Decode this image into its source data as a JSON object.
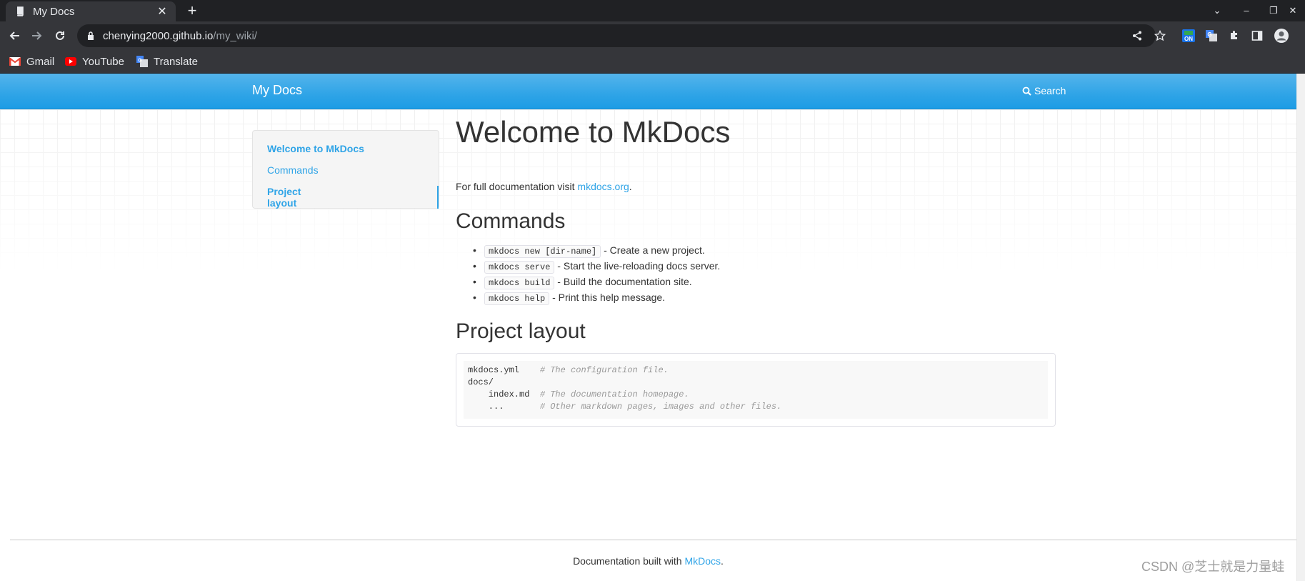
{
  "browser": {
    "tab_title": "My Docs",
    "url_host": "chenying2000.github.io",
    "url_path": "/my_wiki/",
    "bookmarks": [
      {
        "label": "Gmail",
        "icon": "gmail-icon"
      },
      {
        "label": "YouTube",
        "icon": "youtube-icon"
      },
      {
        "label": "Translate",
        "icon": "translate-icon"
      }
    ]
  },
  "site": {
    "brand": "My Docs",
    "search_label": "Search",
    "accent_color": "#2fa4e7"
  },
  "sidebar": {
    "items": [
      {
        "label": "Welcome to MkDocs"
      },
      {
        "label": "Commands"
      },
      {
        "label": "Project layout"
      }
    ]
  },
  "main": {
    "title": "Welcome to MkDocs",
    "intro_prefix": "For full documentation visit ",
    "intro_link": "mkdocs.org",
    "intro_suffix": ".",
    "commands_heading": "Commands",
    "commands": [
      {
        "code": "mkdocs new [dir-name]",
        "desc": " - Create a new project."
      },
      {
        "code": "mkdocs serve",
        "desc": " - Start the live-reloading docs server."
      },
      {
        "code": "mkdocs build",
        "desc": " - Build the documentation site."
      },
      {
        "code": "mkdocs help",
        "desc": " - Print this help message."
      }
    ],
    "layout_heading": "Project layout",
    "layout_lines": [
      {
        "code": "mkdocs.yml    ",
        "comment": "# The configuration file."
      },
      {
        "code": "docs/",
        "comment": ""
      },
      {
        "code": "    index.md  ",
        "comment": "# The documentation homepage."
      },
      {
        "code": "    ...       ",
        "comment": "# Other markdown pages, images and other files."
      }
    ]
  },
  "footer": {
    "prefix": "Documentation built with ",
    "link": "MkDocs",
    "suffix": "."
  },
  "watermark": "CSDN @芝士就是力量蛙"
}
